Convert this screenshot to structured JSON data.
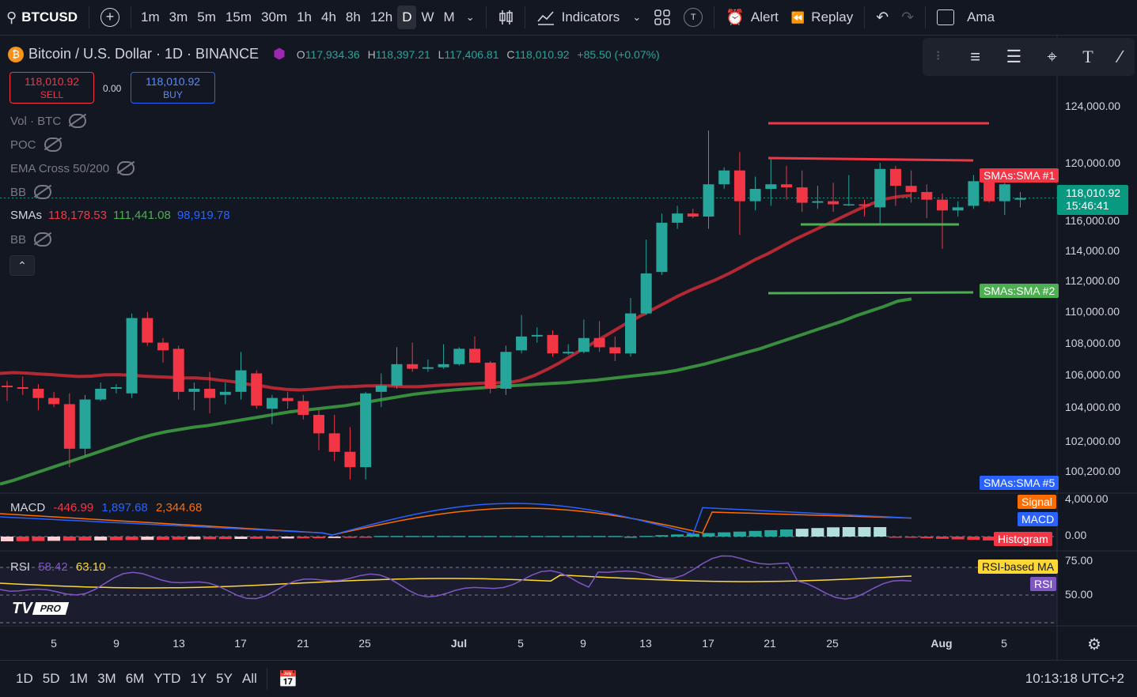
{
  "topbar": {
    "symbol": "BTCUSD",
    "timeframes": [
      "1m",
      "3m",
      "5m",
      "15m",
      "30m",
      "1h",
      "4h",
      "8h",
      "12h",
      "D",
      "W",
      "M"
    ],
    "active_timeframe": "D",
    "indicators_label": "Indicators",
    "alert_label": "Alert",
    "replay_label": "Replay",
    "account_label": "Ama",
    "t_badge": "T"
  },
  "legend": {
    "title": "Bitcoin / U.S. Dollar · 1D · BINANCE",
    "o_key": "O",
    "o_val": "117,934.36",
    "h_key": "H",
    "h_val": "118,397.21",
    "l_key": "L",
    "l_val": "117,406.81",
    "c_key": "C",
    "c_val": "118,010.92",
    "change": "+85.50 (+0.07%)"
  },
  "trade": {
    "sell_price": "118,010.92",
    "sell_label": "SELL",
    "buy_price": "118,010.92",
    "buy_label": "BUY",
    "spread": "0.00"
  },
  "indicators": [
    {
      "label": "Vol · BTC"
    },
    {
      "label": "POC"
    },
    {
      "label": "EMA Cross 50/200"
    },
    {
      "label": "BB"
    },
    {
      "label": "BB"
    }
  ],
  "smas": {
    "label": "SMAs",
    "v1": "118,178.53",
    "v2": "111,441.08",
    "v3": "98,919.78"
  },
  "price_axis": [
    "124,000.00",
    "120,000.00",
    "118,010.92",
    "15:46:41",
    "116,000.00",
    "114,000.00",
    "112,000.00",
    "110,000.00",
    "108,000.00",
    "106,000.00",
    "104,000.00",
    "102,000.00",
    "100,200.00"
  ],
  "tags": {
    "sma1": "SMAs:SMA #1",
    "sma2": "SMAs:SMA #2",
    "sma5": "SMAs:SMA #5",
    "signal": "Signal",
    "macd": "MACD",
    "histogram": "Histogram",
    "rsi_ma": "RSI-based MA",
    "rsi": "RSI"
  },
  "macd": {
    "label": "MACD",
    "v1": "-446.99",
    "v2": "1,897.68",
    "v3": "2,344.68",
    "axis_top": "4,000.00",
    "axis_zero": "0.00"
  },
  "rsi": {
    "label": "RSI",
    "v1": "58.42",
    "v2": "63.10",
    "axis_75": "75.00",
    "axis_50": "50.00"
  },
  "logo_text": "PRO",
  "dates": [
    "5",
    "9",
    "13",
    "17",
    "21",
    "25",
    "Jul",
    "5",
    "9",
    "13",
    "17",
    "21",
    "25",
    "Aug",
    "5"
  ],
  "ranges": [
    "1D",
    "5D",
    "1M",
    "3M",
    "6M",
    "YTD",
    "1Y",
    "5Y",
    "All"
  ],
  "clock": "10:13:18 UTC+2",
  "colors": {
    "up": "#26a69a",
    "down": "#f23645",
    "sma1": "#b22833",
    "sma2": "#388e3c",
    "bg": "#131722"
  },
  "chart_data": {
    "type": "candlestick",
    "ylim": [
      99400,
      125000
    ],
    "candles": [
      [
        105800,
        106100,
        104800,
        105700
      ],
      [
        105700,
        106400,
        105200,
        105600
      ],
      [
        105600,
        105900,
        104200,
        105000
      ],
      [
        105000,
        105400,
        104400,
        104600
      ],
      [
        104600,
        105300,
        100500,
        101700
      ],
      [
        101700,
        105200,
        101200,
        104900
      ],
      [
        104900,
        106000,
        104800,
        105600
      ],
      [
        105600,
        105900,
        105300,
        105700
      ],
      [
        105300,
        110500,
        105000,
        110200
      ],
      [
        110200,
        110600,
        108400,
        108600
      ],
      [
        108600,
        108900,
        107300,
        108100
      ],
      [
        108200,
        108400,
        104900,
        105400
      ],
      [
        105400,
        106000,
        104200,
        105600
      ],
      [
        105600,
        106700,
        104000,
        105000
      ],
      [
        105200,
        106000,
        104600,
        105400
      ],
      [
        105400,
        108000,
        104900,
        106800
      ],
      [
        106600,
        106800,
        104300,
        104500
      ],
      [
        104300,
        105200,
        103300,
        105000
      ],
      [
        105000,
        105400,
        104300,
        104800
      ],
      [
        104800,
        105200,
        103600,
        103900
      ],
      [
        103900,
        104200,
        101600,
        102700
      ],
      [
        102700,
        103900,
        100900,
        101500
      ],
      [
        101500,
        103100,
        99700,
        100500
      ],
      [
        100500,
        105400,
        99700,
        105300
      ],
      [
        105400,
        106600,
        104400,
        105800
      ],
      [
        105800,
        108300,
        105600,
        107200
      ],
      [
        107200,
        108600,
        106700,
        106900
      ],
      [
        106900,
        107500,
        106700,
        107000
      ],
      [
        107000,
        108500,
        106900,
        107200
      ],
      [
        107200,
        108300,
        107100,
        108200
      ],
      [
        108200,
        109000,
        107400,
        107300
      ],
      [
        107300,
        107400,
        105300,
        105600
      ],
      [
        105600,
        108400,
        105200,
        108000
      ],
      [
        108100,
        110400,
        107900,
        109000
      ],
      [
        109000,
        109600,
        108600,
        109100
      ],
      [
        109100,
        109400,
        107700,
        107900
      ],
      [
        107900,
        108500,
        107800,
        108000
      ],
      [
        108000,
        110100,
        107900,
        108900
      ],
      [
        108900,
        110000,
        108000,
        108300
      ],
      [
        108300,
        109000,
        107400,
        107900
      ],
      [
        107900,
        111500,
        107700,
        110500
      ],
      [
        110500,
        115300,
        110400,
        113100
      ],
      [
        113200,
        117000,
        113000,
        116400
      ],
      [
        116400,
        117500,
        116000,
        117000
      ],
      [
        117000,
        117300,
        116700,
        116800
      ],
      [
        116800,
        122400,
        116000,
        118900
      ],
      [
        118900,
        120000,
        118600,
        119800
      ],
      [
        119800,
        121000,
        115600,
        117800
      ],
      [
        117800,
        119400,
        117200,
        118600
      ],
      [
        118600,
        120600,
        117500,
        118900
      ],
      [
        118900,
        120100,
        117900,
        118700
      ],
      [
        118700,
        119800,
        117100,
        117700
      ],
      [
        117700,
        118800,
        117300,
        117800
      ],
      [
        117800,
        119000,
        117100,
        117600
      ],
      [
        117600,
        119500,
        117500,
        117600
      ],
      [
        117600,
        117900,
        116800,
        117500
      ],
      [
        117400,
        120300,
        116300,
        119900
      ],
      [
        119900,
        120100,
        117500,
        118800
      ],
      [
        118800,
        119800,
        117700,
        118400
      ],
      [
        118400,
        118900,
        116700,
        117900
      ],
      [
        117900,
        118300,
        114700,
        117200
      ],
      [
        117200,
        117800,
        116800,
        117400
      ],
      [
        117500,
        119500,
        117300,
        119100
      ],
      [
        119100,
        119800,
        117700,
        117800
      ],
      [
        117800,
        119600,
        116900,
        118900
      ],
      [
        117900,
        118400,
        117400,
        118010
      ]
    ],
    "sma1": [
      106600,
      106650,
      106620,
      106560,
      106520,
      106450,
      106400,
      106420,
      106500,
      106520,
      106480,
      106420,
      106380,
      106350,
      106300,
      106300,
      106250,
      106150,
      106050,
      105900,
      105800,
      105650,
      105560,
      105520,
      105570,
      105650,
      105720,
      105740,
      105780,
      105800,
      105790,
      105740,
      105730,
      105780,
      105840,
      105880,
      105920,
      105960,
      105990,
      106000,
      106150,
      106450,
      106850,
      107300,
      107800,
      108300,
      108800,
      109300,
      109800,
      110250,
      110700,
      111150,
      111600,
      112000,
      112350,
      112700,
      113100,
      113550,
      114000,
      114400,
      114850,
      115300,
      115700,
      116100,
      116500,
      116900,
      117300,
      117650,
      117950,
      118100,
      118179
    ],
    "sma2": [
      99400,
      99650,
      99950,
      100250,
      100550,
      100850,
      101150,
      101450,
      101750,
      102050,
      102350,
      102600,
      102800,
      102950,
      103100,
      103200,
      103350,
      103500,
      103650,
      103800,
      103950,
      104100,
      104200,
      104300,
      104400,
      104500,
      104650,
      104800,
      104950,
      105100,
      105250,
      105350,
      105450,
      105530,
      105600,
      105670,
      105740,
      105800,
      105850,
      105900,
      105950,
      106000,
      106080,
      106150,
      106250,
      106350,
      106450,
      106550,
      106650,
      106800,
      107000,
      107200,
      107450,
      107700,
      107950,
      108200,
      108500,
      108800,
      109100,
      109400,
      109700,
      110000,
      110350,
      110650,
      110950,
      111300,
      111441
    ]
  }
}
